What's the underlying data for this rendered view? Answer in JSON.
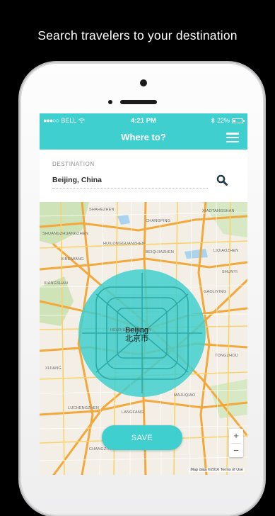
{
  "promo": {
    "caption": "Search travelers to your destination"
  },
  "status_bar": {
    "carrier": "BELL",
    "signal_dots": "●●●○○",
    "time": "4:21 PM",
    "battery": "22%",
    "battery_level": 0.22
  },
  "header": {
    "title": "Where to?",
    "menu_icon": "hamburger-menu-icon"
  },
  "destination": {
    "label": "DESTINATION",
    "value": "Beijing, China",
    "search_icon": "search-icon"
  },
  "map": {
    "city_name": "Beijing",
    "city_name_local": "北京市",
    "radius_color": "#3fcfce",
    "labels": [
      "SHAHEZHEN",
      "CHANGPING",
      "XIAOTANGSHAN",
      "SHUANGZHUANGZHEN",
      "HUILONGGUANZHEN",
      "BEIQIJIAZHEN",
      "LIQIAOZHEN",
      "XIBEIWANG",
      "XIANGSHAN",
      "SHUNYI",
      "GAOLIYING",
      "TONGZHOU",
      "HEIZHUANGHUZHEN",
      "XIJIANG",
      "LUCHENGZHEN",
      "LANGFANG",
      "MAJUQIAO",
      "CHANGZIYING"
    ],
    "zoom_in": "+",
    "zoom_out": "−",
    "attribution": "Map data ©2016    Terms of Use"
  },
  "actions": {
    "save_label": "SAVE"
  },
  "colors": {
    "accent": "#3fcfce",
    "background": "#000000"
  }
}
